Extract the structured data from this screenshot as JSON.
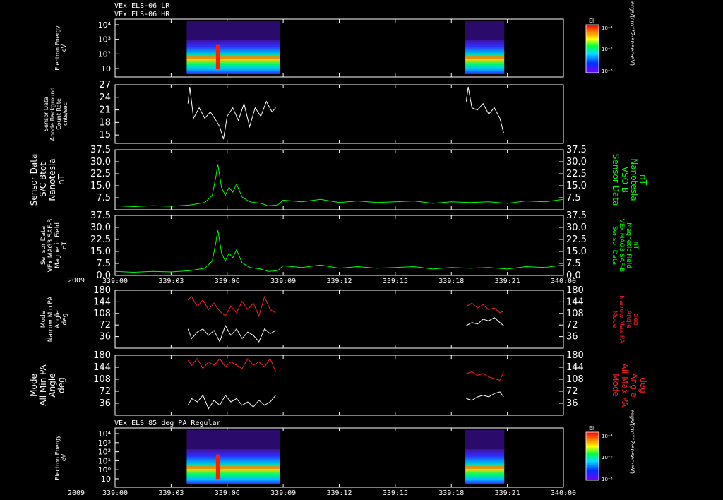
{
  "colors": {
    "background": "#000000",
    "frame": "#ffffff",
    "green": "#00ff00",
    "red": "#ff2020",
    "white": "#ffffff"
  },
  "header": {
    "title1": "VEx ELS-06 LR",
    "title2": "VEx ELS-06 HR",
    "title_bottom": "VEx ELS 85 deg PA Regular"
  },
  "x_axis": {
    "year_label": "2009",
    "ticks": [
      "339:00",
      "339:03",
      "339:06",
      "339:09",
      "339:12",
      "339:15",
      "339:18",
      "339:21",
      "340:00"
    ]
  },
  "colorbar": {
    "label": "El",
    "ticks": [
      "10⁻⁴",
      "10⁻⁶",
      "10⁻⁸"
    ],
    "units": "ergs/(cm**2-sr-sec-eV)"
  },
  "chart_data": [
    {
      "type": "heatmap",
      "panel": "spectrogram-top",
      "ylabel": [
        "Electron Energy",
        "eV"
      ],
      "yticks": [
        "10⁴",
        "10³",
        "10²",
        "10"
      ],
      "yscale": "log",
      "data_intervals": [
        [
          "339:03:50",
          "339:08:50"
        ],
        [
          "339:18:45",
          "339:20:50"
        ]
      ]
    },
    {
      "type": "line",
      "panel": "background-counts",
      "ylabel": [
        "Sensor Data",
        "Anode Background",
        "Count Rate",
        "cnts/sec"
      ],
      "yticks": [
        "27",
        "24",
        "21",
        "18",
        "15"
      ],
      "ylim": [
        13,
        27
      ],
      "series": [
        {
          "color": "#ffffff",
          "x": [
            3.9,
            4.0,
            4.2,
            4.5,
            4.8,
            5.1,
            5.4,
            5.6,
            5.8,
            6.0,
            6.3,
            6.6,
            6.9,
            7.2,
            7.5,
            7.8,
            8.1,
            8.4,
            8.6
          ],
          "y": [
            22.5,
            26.5,
            19.0,
            21.5,
            19.0,
            20.5,
            18.5,
            17.0,
            14.0,
            19.5,
            21.5,
            18.5,
            22.5,
            17.0,
            21.5,
            19.5,
            23.0,
            20.5,
            21.5
          ]
        },
        {
          "color": "#ffffff",
          "x": [
            18.8,
            18.9,
            19.1,
            19.4,
            19.7,
            20.0,
            20.3,
            20.6,
            20.8
          ],
          "y": [
            23.0,
            26.5,
            21.5,
            21.0,
            22.5,
            20.0,
            21.5,
            19.0,
            15.5
          ]
        }
      ]
    },
    {
      "type": "line",
      "panel": "bmag-sc",
      "ylabel": [
        "Sensor Data",
        "S/C Btot",
        "Nanotesla",
        "nT"
      ],
      "ylabel_right": [
        "Sensor Data",
        "VSO B",
        "Nanotesla",
        "nT"
      ],
      "yticks": [
        "37.5",
        "30.0",
        "22.5",
        "15.0",
        "7.5"
      ],
      "ylim": [
        0,
        37.5
      ],
      "series": [
        {
          "color": "#00ff00",
          "x": [
            0,
            1,
            2,
            3,
            4,
            4.8,
            5.2,
            5.4,
            5.5,
            5.7,
            5.9,
            6.1,
            6.3,
            6.5,
            6.8,
            7.2,
            7.8,
            8.2,
            8.7,
            9.0,
            10,
            11,
            12,
            13,
            14,
            15,
            16,
            17,
            18,
            19,
            20,
            21,
            22,
            23,
            24
          ],
          "y": [
            2.5,
            2.0,
            2.5,
            2.2,
            3.0,
            4.5,
            9.0,
            21.0,
            28.5,
            14.0,
            9.0,
            14.0,
            11.0,
            16.0,
            8.0,
            5.0,
            4.0,
            2.5,
            3.0,
            6.0,
            5.0,
            6.5,
            4.5,
            5.5,
            4.5,
            5.0,
            5.5,
            4.0,
            5.0,
            4.5,
            5.0,
            4.0,
            5.5,
            5.0,
            6.5
          ]
        }
      ]
    },
    {
      "type": "line",
      "panel": "bmag-mag3",
      "ylabel": [
        "Sensor Data",
        "VEx MAG3 SAF-B",
        "Magnetic Field",
        "nT"
      ],
      "ylabel_right": [
        "Sensor Data",
        "VEx MAG3 SAF-B",
        "Magnetic Field",
        "nT"
      ],
      "yticks": [
        "37.5",
        "30.0",
        "22.5",
        "15.0",
        "7.5",
        "0.0"
      ],
      "ylim": [
        0,
        37.5
      ],
      "series": [
        {
          "color": "#00ff00",
          "x": [
            0,
            1,
            2,
            3,
            4,
            4.8,
            5.2,
            5.4,
            5.5,
            5.7,
            5.9,
            6.1,
            6.3,
            6.5,
            6.8,
            7.2,
            7.8,
            8.2,
            8.7,
            9.0,
            10,
            11,
            12,
            13,
            14,
            15,
            16,
            17,
            18,
            19,
            20,
            21,
            22,
            23,
            24
          ],
          "y": [
            2.5,
            2.0,
            2.5,
            2.2,
            3.0,
            4.5,
            9.0,
            21.0,
            28.5,
            14.0,
            9.0,
            14.0,
            11.0,
            16.0,
            8.0,
            5.0,
            4.0,
            2.5,
            3.0,
            6.0,
            5.0,
            6.5,
            4.5,
            5.5,
            4.5,
            5.0,
            5.5,
            4.0,
            5.0,
            4.5,
            5.0,
            4.0,
            5.5,
            5.0,
            6.5
          ]
        }
      ]
    },
    {
      "type": "line",
      "panel": "narrow-pa",
      "ylabel": [
        "Mode",
        "Narrow Min PA",
        "Angle",
        "deg"
      ],
      "ylabel_right": [
        "Mode",
        "Narrow Max PA",
        "Angle",
        "deg"
      ],
      "yticks": [
        "180",
        "144",
        "108",
        "72",
        "36"
      ],
      "ylim": [
        0,
        180
      ],
      "series": [
        {
          "color": "#ff2020",
          "x": [
            3.9,
            4.1,
            4.4,
            4.7,
            5.0,
            5.3,
            5.6,
            5.9,
            6.2,
            6.5,
            6.8,
            7.1,
            7.4,
            7.7,
            8.0,
            8.3,
            8.6
          ],
          "y": [
            150,
            160,
            130,
            150,
            120,
            140,
            115,
            100,
            130,
            110,
            145,
            120,
            140,
            100,
            160,
            120,
            110
          ]
        },
        {
          "color": "#ffffff",
          "x": [
            3.9,
            4.1,
            4.4,
            4.7,
            5.0,
            5.3,
            5.6,
            5.9,
            6.2,
            6.5,
            6.8,
            7.1,
            7.4,
            7.7,
            8.0,
            8.3,
            8.6
          ],
          "y": [
            60,
            30,
            50,
            60,
            40,
            55,
            20,
            70,
            40,
            60,
            30,
            50,
            40,
            20,
            60,
            45,
            55
          ]
        },
        {
          "color": "#ff2020",
          "x": [
            18.8,
            19.1,
            19.4,
            19.7,
            20.0,
            20.3,
            20.6,
            20.8
          ],
          "y": [
            130,
            140,
            125,
            135,
            120,
            125,
            110,
            115
          ]
        },
        {
          "color": "#ffffff",
          "x": [
            18.8,
            19.1,
            19.4,
            19.7,
            20.0,
            20.3,
            20.6,
            20.8
          ],
          "y": [
            70,
            80,
            75,
            90,
            85,
            95,
            80,
            70
          ]
        }
      ]
    },
    {
      "type": "line",
      "panel": "all-pa",
      "ylabel": [
        "Mode",
        "All Min PA",
        "Angle",
        "deg"
      ],
      "ylabel_right": [
        "Mode",
        "All Max PA",
        "Angle",
        "deg"
      ],
      "yticks": [
        "180",
        "144",
        "108",
        "72",
        "36"
      ],
      "ylim": [
        0,
        180
      ],
      "series": [
        {
          "color": "#ff2020",
          "x": [
            3.9,
            4.1,
            4.4,
            4.7,
            5.0,
            5.3,
            5.6,
            5.9,
            6.2,
            6.5,
            6.8,
            7.1,
            7.4,
            7.7,
            8.0,
            8.3,
            8.6
          ],
          "y": [
            165,
            150,
            170,
            140,
            160,
            150,
            170,
            145,
            160,
            150,
            140,
            170,
            150,
            160,
            145,
            170,
            130
          ]
        },
        {
          "color": "#ffffff",
          "x": [
            3.9,
            4.1,
            4.4,
            4.7,
            5.0,
            5.3,
            5.6,
            5.9,
            6.2,
            6.5,
            6.8,
            7.1,
            7.4,
            7.7,
            8.0,
            8.3,
            8.6
          ],
          "y": [
            30,
            50,
            40,
            60,
            20,
            45,
            30,
            60,
            40,
            50,
            30,
            40,
            25,
            45,
            30,
            40,
            60
          ]
        },
        {
          "color": "#ff2020",
          "x": [
            18.8,
            19.1,
            19.4,
            19.7,
            20.0,
            20.3,
            20.6,
            20.8
          ],
          "y": [
            125,
            130,
            120,
            125,
            115,
            110,
            105,
            130
          ]
        },
        {
          "color": "#ffffff",
          "x": [
            18.8,
            19.1,
            19.4,
            19.7,
            20.0,
            20.3,
            20.6,
            20.8
          ],
          "y": [
            50,
            45,
            55,
            60,
            55,
            65,
            70,
            55
          ]
        }
      ]
    },
    {
      "type": "heatmap",
      "panel": "spectrogram-bottom",
      "ylabel": [
        "Electron Energy",
        "eV"
      ],
      "yticks": [
        "10⁴",
        "10³",
        "10²",
        "10¹",
        "10⁰",
        "10"
      ],
      "yscale": "log",
      "data_intervals": [
        [
          "339:03:50",
          "339:08:50"
        ],
        [
          "339:18:45",
          "339:20:50"
        ]
      ]
    }
  ]
}
